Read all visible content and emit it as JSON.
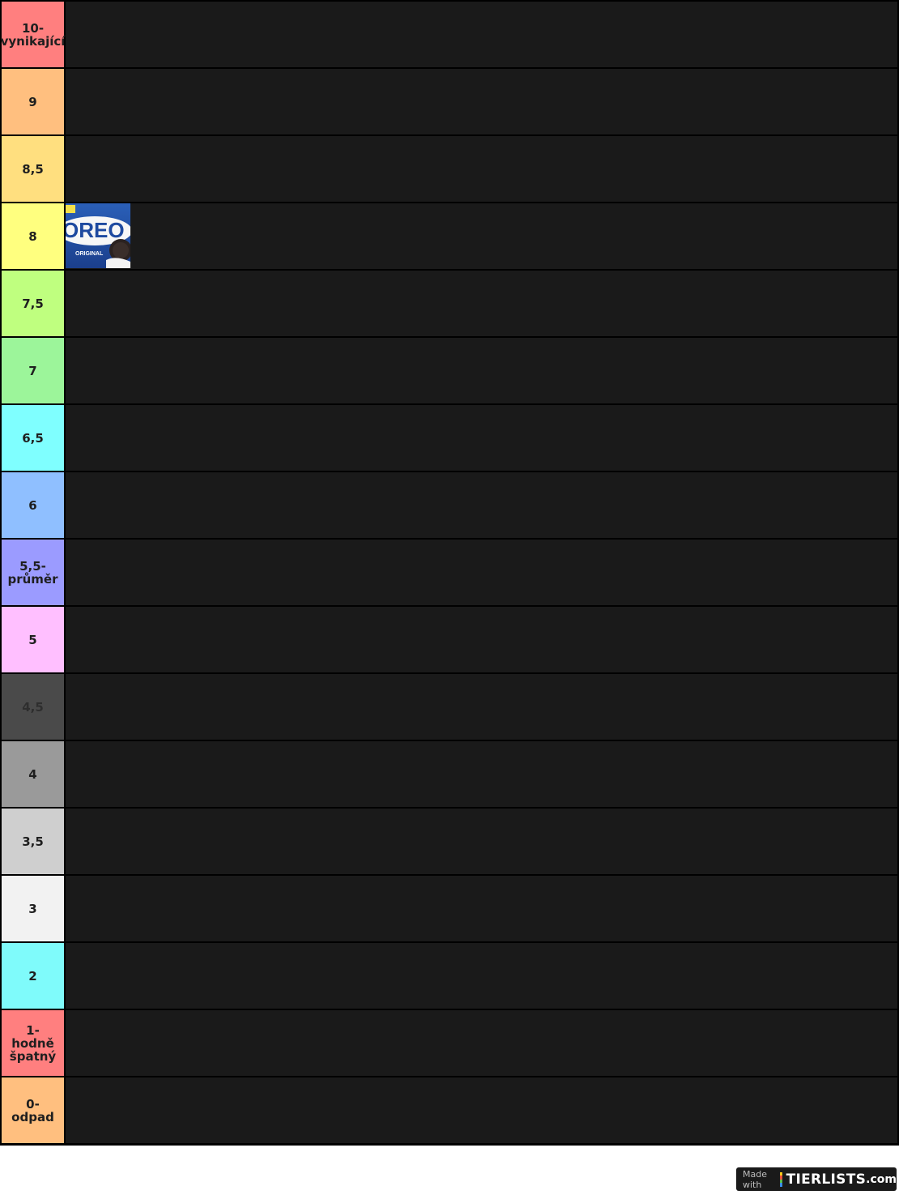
{
  "tiers": [
    {
      "label": "10-\nvynikající",
      "color": "#ff7f7f",
      "text_color": "#1f1f1f"
    },
    {
      "label": "9",
      "color": "#ffbf7f",
      "text_color": "#1f1f1f"
    },
    {
      "label": "8,5",
      "color": "#ffdf7f",
      "text_color": "#1f1f1f"
    },
    {
      "label": "8",
      "color": "#ffff7f",
      "text_color": "#1f1f1f",
      "items": [
        {
          "name": "Oreo Original",
          "image_text": "OREO",
          "subtext": "ORIGINAL"
        }
      ]
    },
    {
      "label": "7,5",
      "color": "#bfff7f",
      "text_color": "#1f1f1f"
    },
    {
      "label": "7",
      "color": "#9cf59a",
      "text_color": "#1f1f1f"
    },
    {
      "label": "6,5",
      "color": "#7fffff",
      "text_color": "#1f1f1f"
    },
    {
      "label": "6",
      "color": "#8fbfff",
      "text_color": "#1f1f1f"
    },
    {
      "label": "5,5-\nprůměr",
      "color": "#9b9bff",
      "text_color": "#1f1f1f"
    },
    {
      "label": "5",
      "color": "#ffbfff",
      "text_color": "#1f1f1f"
    },
    {
      "label": "4,5",
      "color": "#4a4a4a",
      "text_color": "#2e2e2e"
    },
    {
      "label": "4",
      "color": "#9a9a9a",
      "text_color": "#1f1f1f"
    },
    {
      "label": "3,5",
      "color": "#cfcfcf",
      "text_color": "#1f1f1f"
    },
    {
      "label": "3",
      "color": "#f2f2f2",
      "text_color": "#1f1f1f"
    },
    {
      "label": "2",
      "color": "#7ffbfb",
      "text_color": "#1f1f1f"
    },
    {
      "label": "1- hodně\nšpatný",
      "color": "#ff7f7f",
      "text_color": "#1f1f1f"
    },
    {
      "label": "0- odpad",
      "color": "#ffbf7f",
      "text_color": "#1f1f1f"
    }
  ],
  "watermark": {
    "made_with": "Made with",
    "brand": "TIERLISTS",
    "tld": ".com",
    "bar_colors": [
      "#f5c518",
      "#e8503a",
      "#5bbf4a",
      "#3a8ee8"
    ]
  }
}
